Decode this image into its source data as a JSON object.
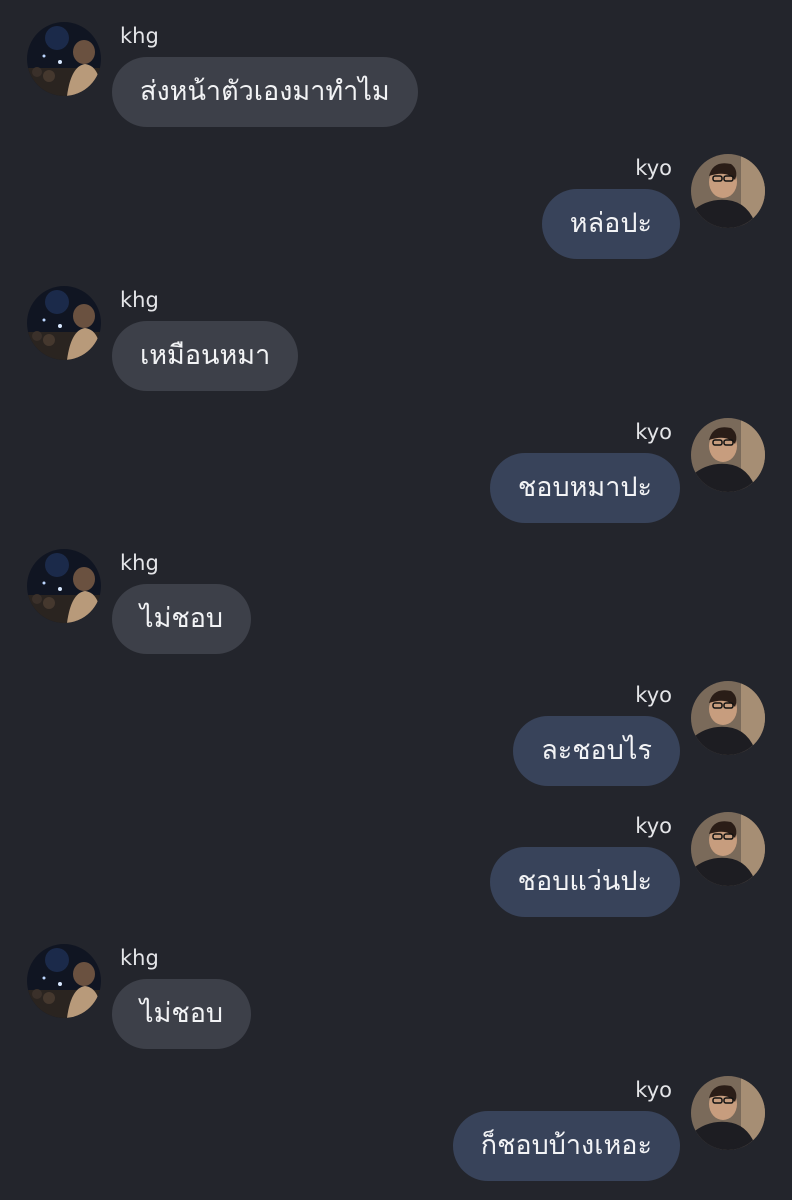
{
  "colors": {
    "background": "#23252c",
    "incoming_bubble": "#3d4049",
    "outgoing_bubble": "#38435a",
    "text": "#f2f3f5",
    "name": "#e4e5e8"
  },
  "messages": [
    {
      "sender": "khg",
      "side": "left",
      "text": "ส่งหน้าตัวเองมาทำไม"
    },
    {
      "sender": "kyo",
      "side": "right",
      "text": "หล่อปะ"
    },
    {
      "sender": "khg",
      "side": "left",
      "text": "เหมือนหมา"
    },
    {
      "sender": "kyo",
      "side": "right",
      "text": "ชอบหมาปะ"
    },
    {
      "sender": "khg",
      "side": "left",
      "text": "ไม่ชอบ"
    },
    {
      "sender": "kyo",
      "side": "right",
      "text": "ละชอบไร"
    },
    {
      "sender": "kyo",
      "side": "right",
      "text": "ชอบแว่นปะ"
    },
    {
      "sender": "khg",
      "side": "left",
      "text": "ไม่ชอบ"
    },
    {
      "sender": "kyo",
      "side": "right",
      "text": "ก็ชอบบ้างเหอะ"
    }
  ]
}
